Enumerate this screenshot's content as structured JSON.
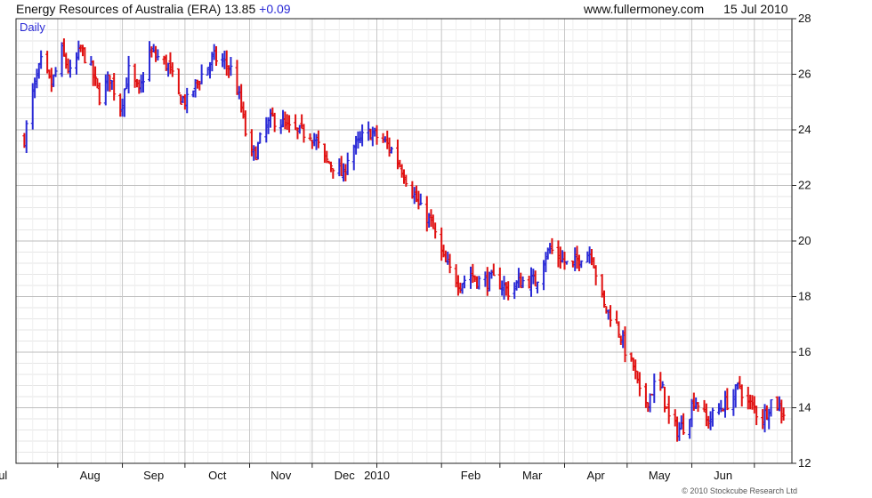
{
  "header": {
    "title": "Energy Resources of Australia (ERA)",
    "price": "13.85",
    "change": "+0.09",
    "source": "www.fullermoney.com",
    "date": "15 Jul 2010"
  },
  "chart_data": {
    "type": "ohlc",
    "period": "Daily",
    "grid": true,
    "ylim": [
      12,
      28
    ],
    "y_ticks": [
      12,
      14,
      16,
      18,
      20,
      22,
      24,
      26,
      28
    ],
    "x_ticks": [
      "Aug",
      "Sep",
      "Oct",
      "Nov",
      "Dec",
      "2010",
      "Feb",
      "Mar",
      "Apr",
      "May",
      "Jun",
      "Jul"
    ],
    "up_color": "#2b2bd6",
    "down_color": "#e01010",
    "close_path": [
      [
        "2009-07-16",
        23.7
      ],
      [
        "2009-07-20",
        25.3
      ],
      [
        "2009-07-24",
        26.4
      ],
      [
        "2009-07-29",
        25.6
      ],
      [
        "2009-08-03",
        26.8
      ],
      [
        "2009-08-07",
        26.0
      ],
      [
        "2009-08-12",
        26.9
      ],
      [
        "2009-08-16",
        26.4
      ],
      [
        "2009-08-21",
        25.2
      ],
      [
        "2009-08-26",
        25.9
      ],
      [
        "2009-08-31",
        24.8
      ],
      [
        "2009-09-04",
        26.1
      ],
      [
        "2009-09-09",
        25.3
      ],
      [
        "2009-09-14",
        26.8
      ],
      [
        "2009-09-18",
        26.6
      ],
      [
        "2009-09-23",
        26.3
      ],
      [
        "2009-09-28",
        25.2
      ],
      [
        "2009-10-02",
        25.0
      ],
      [
        "2009-10-06",
        25.6
      ],
      [
        "2009-10-10",
        26.1
      ],
      [
        "2009-10-15",
        26.6
      ],
      [
        "2009-10-20",
        26.4
      ],
      [
        "2009-10-24",
        26.1
      ],
      [
        "2009-10-28",
        24.8
      ],
      [
        "2009-11-01",
        23.0
      ],
      [
        "2009-11-04",
        23.2
      ],
      [
        "2009-11-08",
        24.0
      ],
      [
        "2009-11-12",
        24.4
      ],
      [
        "2009-11-16",
        24.3
      ],
      [
        "2009-11-20",
        24.0
      ],
      [
        "2009-11-25",
        23.9
      ],
      [
        "2009-11-30",
        23.9
      ],
      [
        "2009-12-04",
        23.4
      ],
      [
        "2009-12-07",
        22.9
      ],
      [
        "2009-12-12",
        22.7
      ],
      [
        "2009-12-16",
        22.3
      ],
      [
        "2009-12-19",
        23.4
      ],
      [
        "2009-12-22",
        23.4
      ],
      [
        "2009-12-25",
        23.7
      ],
      [
        "2009-12-29",
        23.9
      ],
      [
        "2010-01-04",
        23.6
      ],
      [
        "2010-01-09",
        23.2
      ],
      [
        "2010-01-13",
        22.6
      ],
      [
        "2010-01-18",
        21.8
      ],
      [
        "2010-01-22",
        21.1
      ],
      [
        "2010-01-26",
        20.8
      ],
      [
        "2010-01-30",
        20.0
      ],
      [
        "2010-02-02",
        19.3
      ],
      [
        "2010-02-06",
        18.8
      ],
      [
        "2010-02-10",
        18.5
      ],
      [
        "2010-02-15",
        18.8
      ],
      [
        "2010-02-20",
        18.5
      ],
      [
        "2010-02-25",
        18.6
      ],
      [
        "2010-03-01",
        18.5
      ],
      [
        "2010-03-05",
        18.2
      ],
      [
        "2010-03-10",
        18.5
      ],
      [
        "2010-03-14",
        18.6
      ],
      [
        "2010-03-18",
        18.5
      ],
      [
        "2010-03-22",
        19.4
      ],
      [
        "2010-03-25",
        19.7
      ],
      [
        "2010-03-30",
        19.4
      ],
      [
        "2010-04-04",
        19.0
      ],
      [
        "2010-04-09",
        19.5
      ],
      [
        "2010-04-14",
        19.6
      ],
      [
        "2010-04-17",
        18.5
      ],
      [
        "2010-04-20",
        17.6
      ],
      [
        "2010-04-24",
        17.3
      ],
      [
        "2010-04-28",
        16.6
      ],
      [
        "2010-05-02",
        15.6
      ],
      [
        "2010-05-04",
        15.5
      ],
      [
        "2010-05-08",
        14.1
      ],
      [
        "2010-05-11",
        14.3
      ],
      [
        "2010-05-14",
        14.8
      ],
      [
        "2010-05-18",
        14.6
      ],
      [
        "2010-05-21",
        13.6
      ],
      [
        "2010-05-25",
        13.2
      ],
      [
        "2010-05-29",
        13.4
      ],
      [
        "2010-06-02",
        14.3
      ],
      [
        "2010-06-05",
        14.1
      ],
      [
        "2010-06-08",
        13.5
      ],
      [
        "2010-06-11",
        13.7
      ],
      [
        "2010-06-16",
        14.1
      ],
      [
        "2010-06-20",
        14.3
      ],
      [
        "2010-06-24",
        14.8
      ],
      [
        "2010-06-27",
        14.2
      ],
      [
        "2010-07-01",
        14.0
      ],
      [
        "2010-07-04",
        13.5
      ],
      [
        "2010-07-07",
        13.9
      ],
      [
        "2010-07-10",
        14.4
      ],
      [
        "2010-07-13",
        14.0
      ],
      [
        "2010-07-15",
        13.85
      ]
    ],
    "copyright": "© 2010 Stockcube Research Ltd"
  }
}
